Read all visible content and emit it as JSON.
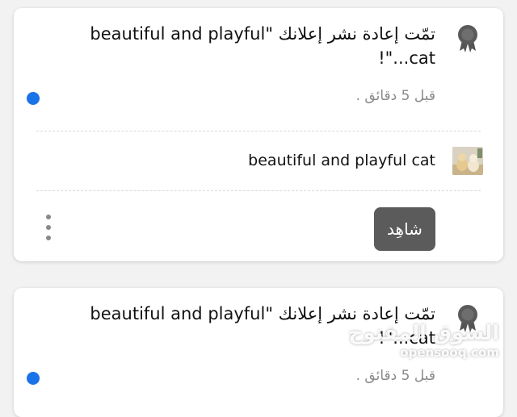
{
  "notifications": [
    {
      "message": "تمّت إعادة نشر إعلانك \"beautiful and playful cat...\"!",
      "time": "قبل 5 دقائق .",
      "unread": true,
      "icon": "award-badge-icon",
      "ad": {
        "title": "beautiful and playful cat",
        "thumbnail": "cat-photo-thumbnail"
      },
      "action_label": "شاهِد",
      "menu_icon": "more-vertical-icon"
    },
    {
      "message": "تمّت إعادة نشر إعلانك \"beautiful and playful cat...\"!",
      "time": "قبل 5 دقائق .",
      "unread": true,
      "icon": "award-badge-icon"
    }
  ],
  "watermark": {
    "arabic": "السوق المفتوح",
    "latin": "opensooq.com"
  },
  "colors": {
    "unread_dot": "#1a73e8",
    "button_bg": "#5b5b5b",
    "time_text": "#8a8a8a"
  }
}
